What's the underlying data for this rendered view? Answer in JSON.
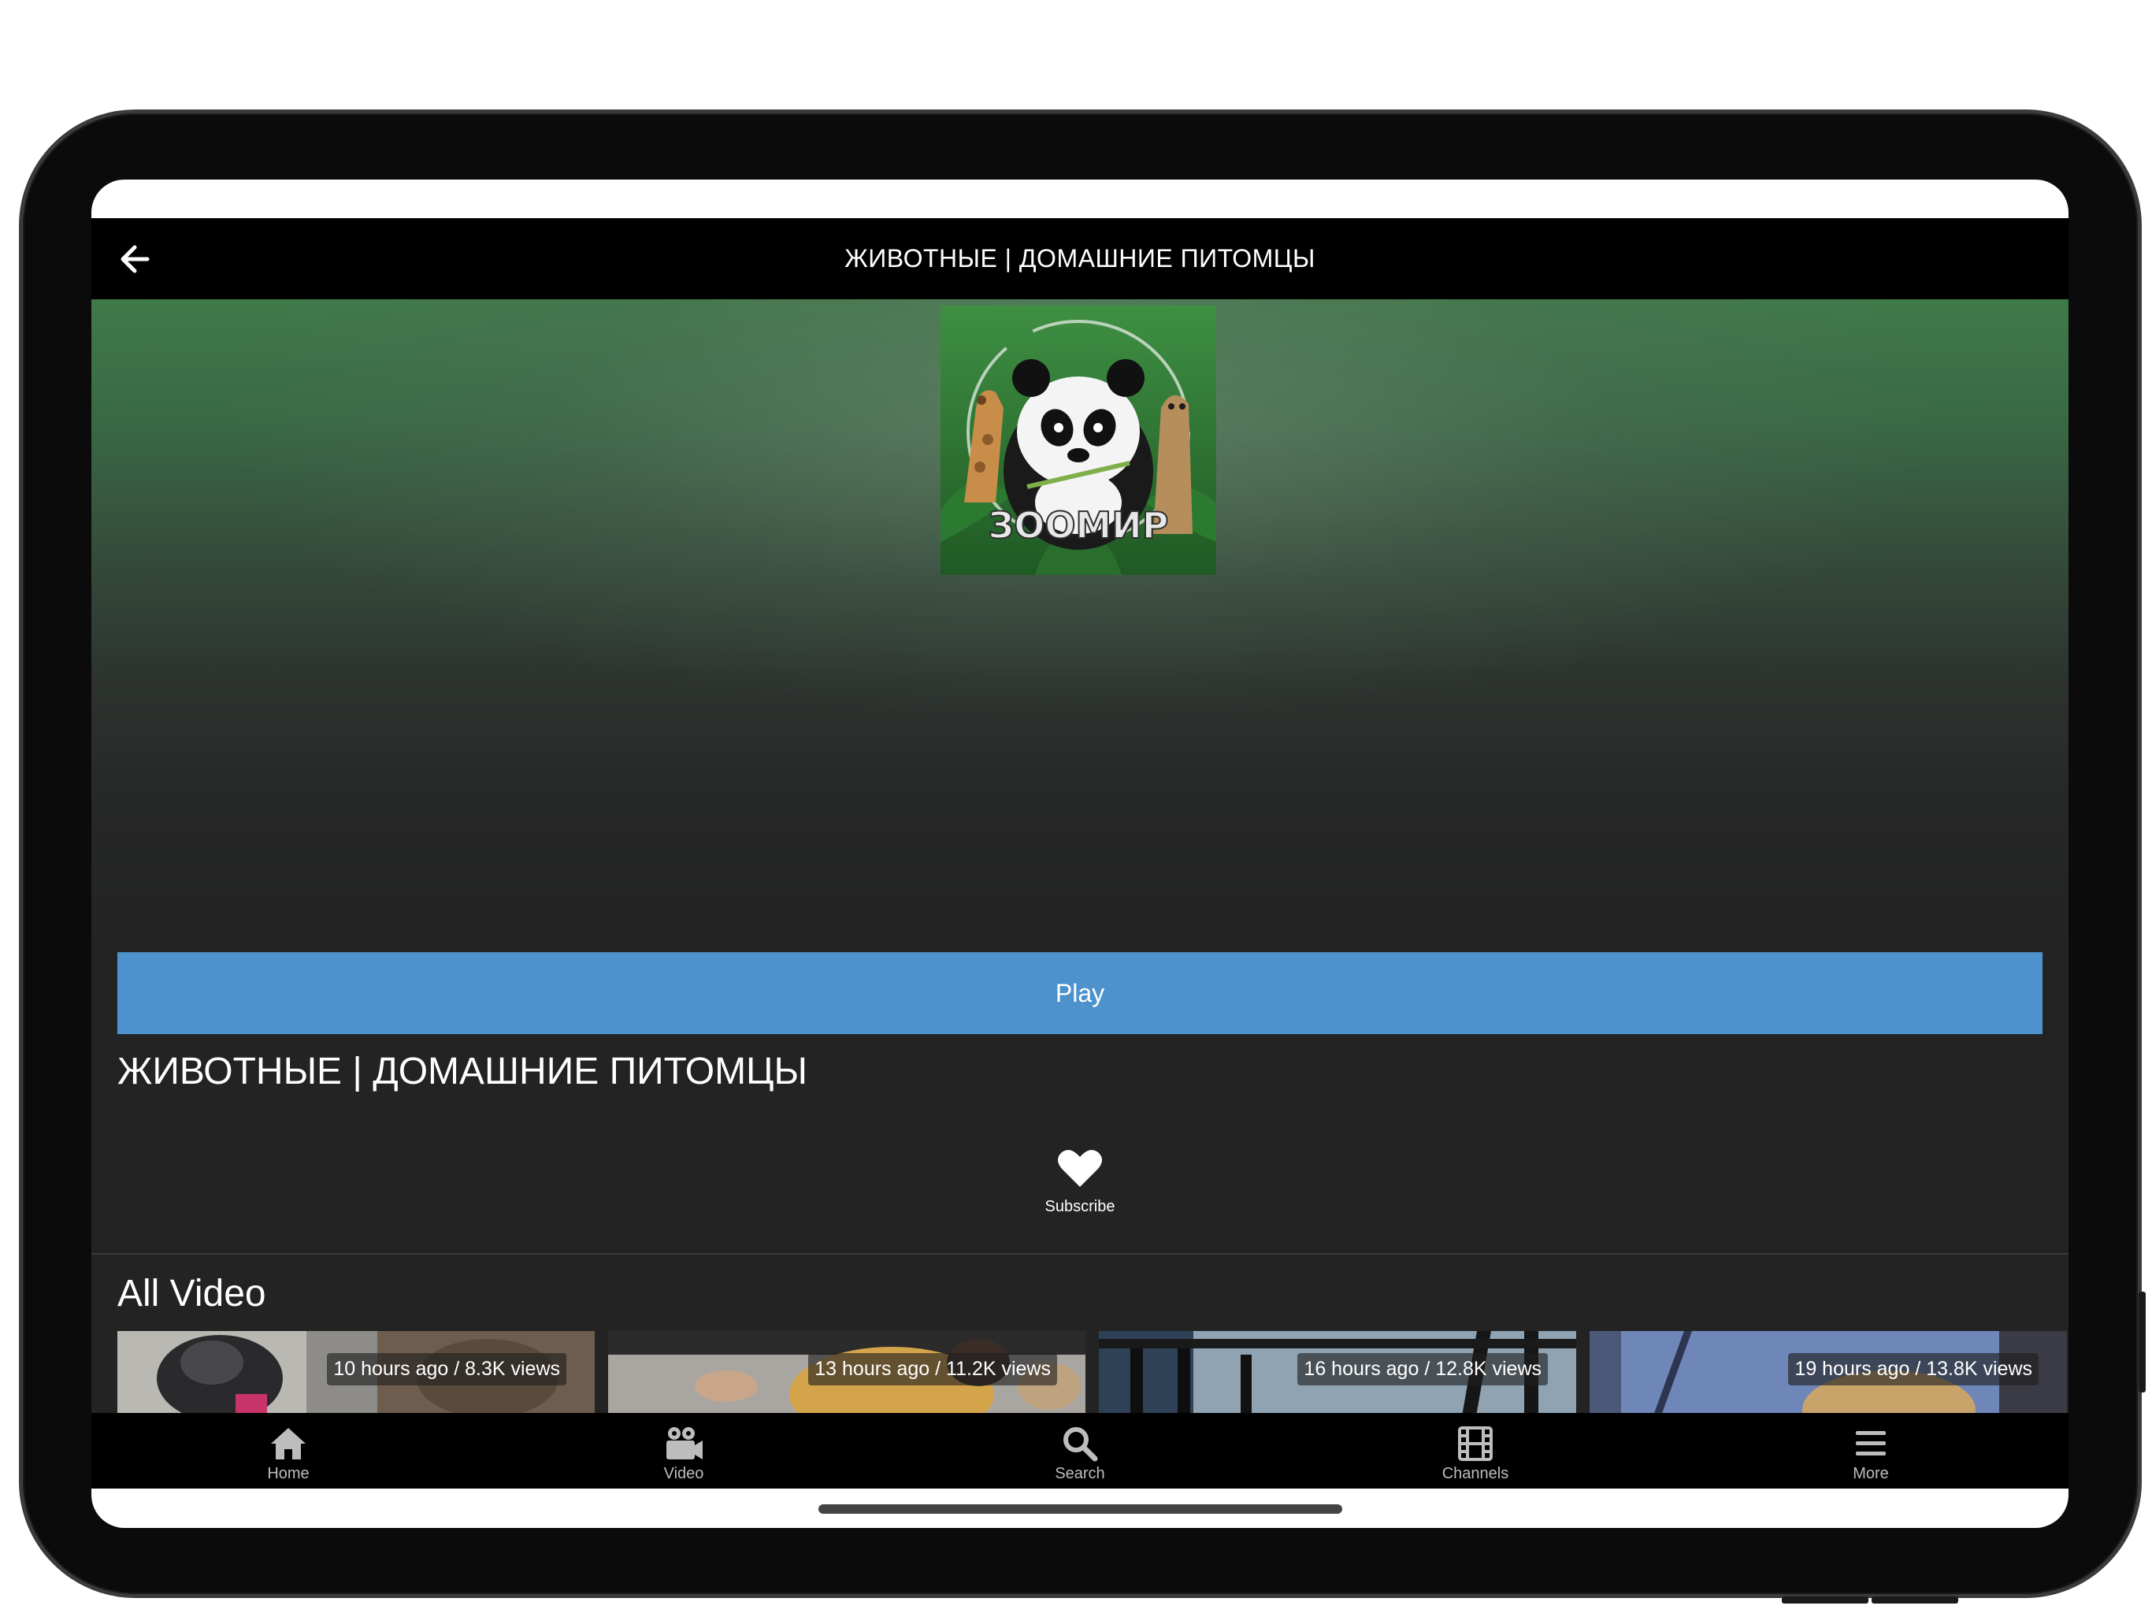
{
  "header": {
    "title": "ЖИВОТНЫЕ | ДОМАШНИЕ ПИТОМЦЫ"
  },
  "hero": {
    "logo_text": "ЗООМИР"
  },
  "channel": {
    "title": "ЖИВОТНЫЕ | ДОМАШНИЕ ПИТОМЦЫ",
    "play_label": "Play",
    "subscribe_label": "Subscribe"
  },
  "all_video": {
    "title": "All Video",
    "items": [
      {
        "meta": "10 hours ago / 8.3K views"
      },
      {
        "meta": "13 hours ago / 11.2K views"
      },
      {
        "meta": "16 hours ago / 12.8K views"
      },
      {
        "meta": "19 hours ago / 13.8K views"
      }
    ]
  },
  "tabs": [
    {
      "label": "Home",
      "icon": "home-icon"
    },
    {
      "label": "Video",
      "icon": "video-camera-icon"
    },
    {
      "label": "Search",
      "icon": "search-icon"
    },
    {
      "label": "Channels",
      "icon": "film-icon"
    },
    {
      "label": "More",
      "icon": "menu-icon"
    }
  ],
  "colors": {
    "accent": "#4d92cc",
    "background": "#232323",
    "bar": "#000000",
    "hero_green": "#3f7a49"
  }
}
